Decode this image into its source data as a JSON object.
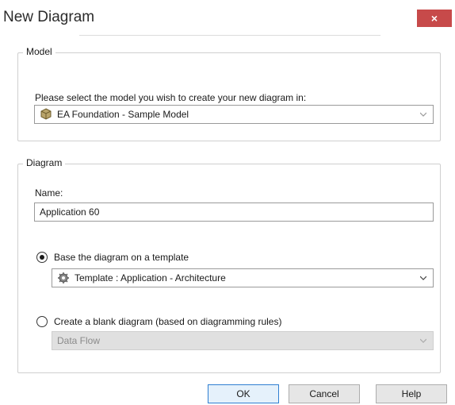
{
  "window": {
    "title": "New Diagram",
    "close_glyph": "×"
  },
  "model_group": {
    "legend": "Model",
    "prompt": "Please select the model you wish to create your new diagram in:",
    "selected_model": "EA Foundation - Sample Model",
    "icon": "model-package-icon"
  },
  "diagram_group": {
    "legend": "Diagram",
    "name_label": "Name:",
    "name_value": "Application 60",
    "option_template": {
      "label": "Base the diagram on a template",
      "selected": true,
      "template_value": "Template : Application - Architecture",
      "icon": "template-gear-icon"
    },
    "option_blank": {
      "label": "Create a blank diagram (based on diagramming rules)",
      "selected": false,
      "type_value": "Data Flow",
      "disabled": true
    }
  },
  "buttons": {
    "ok": "OK",
    "cancel": "Cancel",
    "help": "Help"
  },
  "colors": {
    "close_button": "#c74a4a",
    "default_button_border": "#2f7fd1",
    "disabled_field": "#e0e0e0"
  }
}
